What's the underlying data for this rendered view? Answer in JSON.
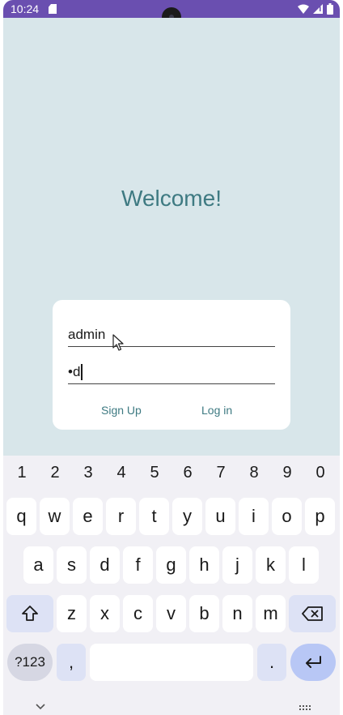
{
  "status": {
    "time": "10:24",
    "icons": [
      "sd-card-icon",
      "wifi-icon",
      "signal-icon",
      "battery-icon"
    ]
  },
  "app": {
    "welcome": "Welcome!",
    "username_value": "admin",
    "password_value": "•d",
    "signup_label": "Sign Up",
    "login_label": "Log in"
  },
  "colors": {
    "status_bar": "#6a4fb0",
    "app_background": "#d8e6ea",
    "accent": "#3e7a82"
  },
  "keyboard": {
    "numbers": [
      "1",
      "2",
      "3",
      "4",
      "5",
      "6",
      "7",
      "8",
      "9",
      "0"
    ],
    "row1": [
      "q",
      "w",
      "e",
      "r",
      "t",
      "y",
      "u",
      "i",
      "o",
      "p"
    ],
    "row2": [
      "a",
      "s",
      "d",
      "f",
      "g",
      "h",
      "j",
      "k",
      "l"
    ],
    "row3": [
      "z",
      "x",
      "c",
      "v",
      "b",
      "n",
      "m"
    ],
    "symbols_label": "?123",
    "comma": ",",
    "period": "."
  }
}
